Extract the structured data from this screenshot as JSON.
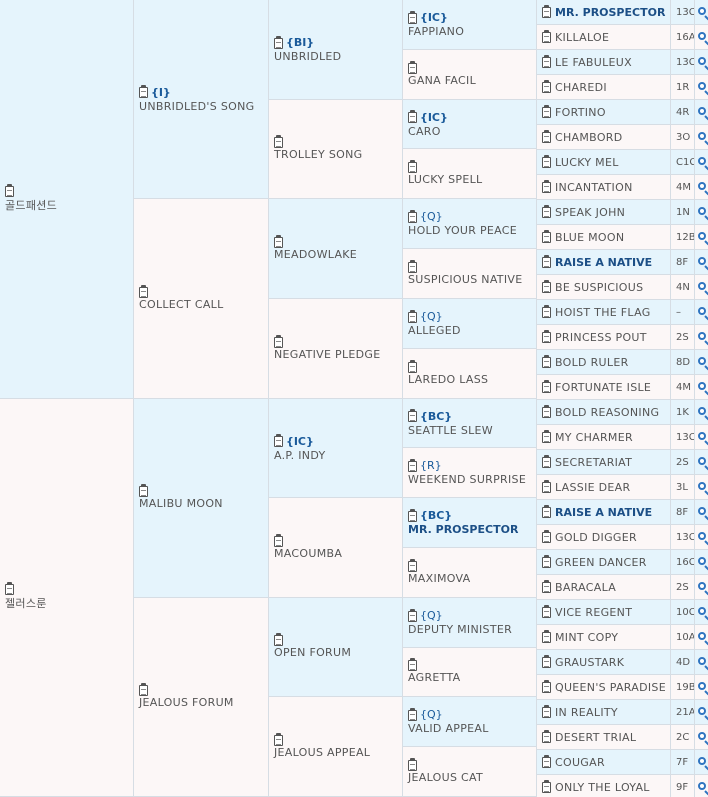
{
  "pedigree": {
    "gen1": [
      {
        "name": "골드패션드",
        "badge": "",
        "bold": false
      },
      {
        "name": "젤러스룬",
        "badge": "",
        "bold": false
      }
    ],
    "gen2": [
      {
        "name": "UNBRIDLED'S SONG",
        "badge": "{I}",
        "bold": false
      },
      {
        "name": "COLLECT CALL",
        "badge": "",
        "bold": false
      },
      {
        "name": "MALIBU MOON",
        "badge": "",
        "bold": false
      },
      {
        "name": "JEALOUS FORUM",
        "badge": "",
        "bold": false
      }
    ],
    "gen3": [
      {
        "name": "UNBRIDLED",
        "badge": "{BI}",
        "bold": false
      },
      {
        "name": "TROLLEY SONG",
        "badge": "",
        "bold": false
      },
      {
        "name": "MEADOWLAKE",
        "badge": "",
        "bold": false
      },
      {
        "name": "NEGATIVE PLEDGE",
        "badge": "",
        "bold": false
      },
      {
        "name": "A.P. INDY",
        "badge": "{IC}",
        "bold": false
      },
      {
        "name": "MACOUMBA",
        "badge": "",
        "bold": false
      },
      {
        "name": "OPEN FORUM",
        "badge": "",
        "bold": false
      },
      {
        "name": "JEALOUS APPEAL",
        "badge": "",
        "bold": false
      }
    ],
    "gen4": [
      {
        "name": "FAPPIANO",
        "badge": "{IC}",
        "bold": false
      },
      {
        "name": "GANA FACIL",
        "badge": "",
        "bold": false
      },
      {
        "name": "CARO",
        "badge": "{IC}",
        "bold": false
      },
      {
        "name": "LUCKY SPELL",
        "badge": "",
        "bold": false
      },
      {
        "name": "HOLD YOUR PEACE",
        "badge": "{Q}",
        "bold": false
      },
      {
        "name": "SUSPICIOUS NATIVE",
        "badge": "",
        "bold": false
      },
      {
        "name": "ALLEGED",
        "badge": "{Q}",
        "bold": false
      },
      {
        "name": "LAREDO LASS",
        "badge": "",
        "bold": false
      },
      {
        "name": "SEATTLE SLEW",
        "badge": "{BC}",
        "bold": false
      },
      {
        "name": "WEEKEND SURPRISE",
        "badge": "{R}",
        "bold": false
      },
      {
        "name": "MR. PROSPECTOR",
        "badge": "{BC}",
        "bold": true
      },
      {
        "name": "MAXIMOVA",
        "badge": "",
        "bold": false
      },
      {
        "name": "DEPUTY MINISTER",
        "badge": "{Q}",
        "bold": false
      },
      {
        "name": "AGRETTA",
        "badge": "",
        "bold": false
      },
      {
        "name": "VALID APPEAL",
        "badge": "{Q}",
        "bold": false
      },
      {
        "name": "JEALOUS CAT",
        "badge": "",
        "bold": false
      }
    ],
    "gen5": [
      {
        "name": "MR. PROSPECTOR",
        "code": "13C",
        "bold": true
      },
      {
        "name": "KILLALOE",
        "code": "16A",
        "bold": false
      },
      {
        "name": "LE FABULEUX",
        "code": "13C",
        "bold": false
      },
      {
        "name": "CHAREDI",
        "code": "1R",
        "bold": false
      },
      {
        "name": "FORTINO",
        "code": "4R",
        "bold": false
      },
      {
        "name": "CHAMBORD",
        "code": "3O",
        "bold": false
      },
      {
        "name": "LUCKY MEL",
        "code": "C1C",
        "bold": false
      },
      {
        "name": "INCANTATION",
        "code": "4M",
        "bold": false
      },
      {
        "name": "SPEAK JOHN",
        "code": "1N",
        "bold": false
      },
      {
        "name": "BLUE MOON",
        "code": "12B",
        "bold": false
      },
      {
        "name": "RAISE A NATIVE",
        "code": "8F",
        "bold": true
      },
      {
        "name": "BE SUSPICIOUS",
        "code": "4N",
        "bold": false
      },
      {
        "name": "HOIST THE FLAG",
        "code": "–",
        "bold": false
      },
      {
        "name": "PRINCESS POUT",
        "code": "2S",
        "bold": false
      },
      {
        "name": "BOLD RULER",
        "code": "8D",
        "bold": false
      },
      {
        "name": "FORTUNATE ISLE",
        "code": "4M",
        "bold": false
      },
      {
        "name": "BOLD REASONING",
        "code": "1K",
        "bold": false
      },
      {
        "name": "MY CHARMER",
        "code": "13C",
        "bold": false
      },
      {
        "name": "SECRETARIAT",
        "code": "2S",
        "bold": false
      },
      {
        "name": "LASSIE DEAR",
        "code": "3L",
        "bold": false
      },
      {
        "name": "RAISE A NATIVE",
        "code": "8F",
        "bold": true
      },
      {
        "name": "GOLD DIGGER",
        "code": "13C",
        "bold": false
      },
      {
        "name": "GREEN DANCER",
        "code": "16C",
        "bold": false
      },
      {
        "name": "BARACALA",
        "code": "2S",
        "bold": false
      },
      {
        "name": "VICE REGENT",
        "code": "10C",
        "bold": false
      },
      {
        "name": "MINT COPY",
        "code": "10A",
        "bold": false
      },
      {
        "name": "GRAUSTARK",
        "code": "4D",
        "bold": false
      },
      {
        "name": "QUEEN'S PARADISE",
        "code": "19B",
        "bold": false
      },
      {
        "name": "IN REALITY",
        "code": "21A",
        "bold": false
      },
      {
        "name": "DESERT TRIAL",
        "code": "2C",
        "bold": false
      },
      {
        "name": "COUGAR",
        "code": "7F",
        "bold": false
      },
      {
        "name": "ONLY THE LOYAL",
        "code": "9F",
        "bold": false
      }
    ]
  },
  "icons": {
    "clipboard": "clipboard-icon",
    "magnifier": "magnifier-icon"
  },
  "colors": {
    "blue": "#e5f4fc",
    "pink": "#fcf7f7",
    "border": "#d6dde4",
    "link": "#1c4f86"
  }
}
